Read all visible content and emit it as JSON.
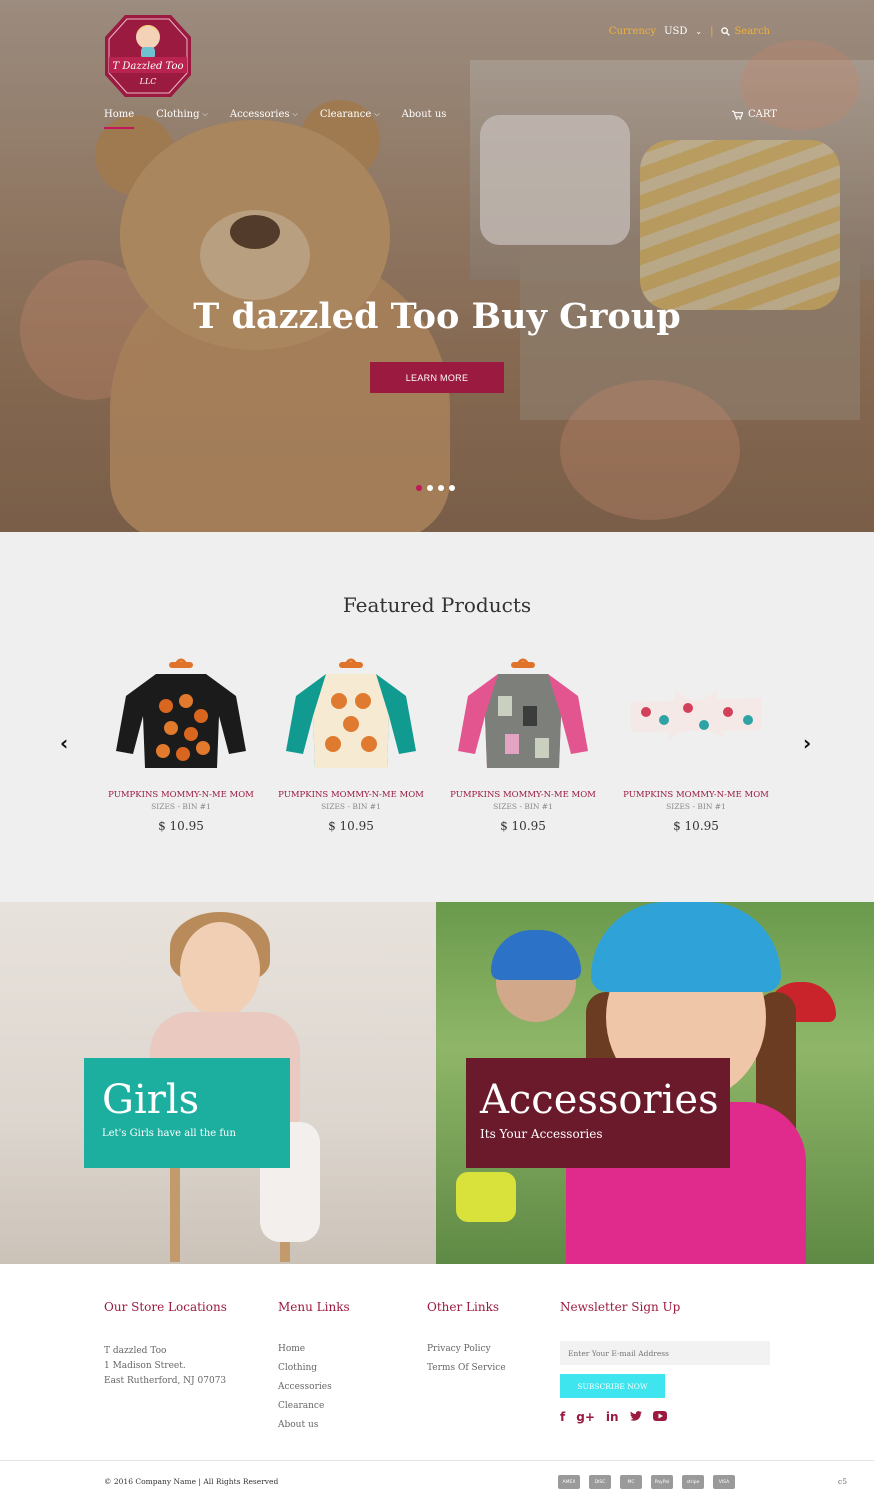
{
  "header": {
    "logo_text": "T Dazzled Too LLC",
    "currency_label": "Currency",
    "currency_value": "USD",
    "search_label": "Search",
    "cart_label": "CART",
    "nav": [
      {
        "label": "Home",
        "active": true
      },
      {
        "label": "Clothing",
        "has_dropdown": true
      },
      {
        "label": "Accessories",
        "has_dropdown": true
      },
      {
        "label": "Clearance",
        "has_dropdown": true
      },
      {
        "label": "About us"
      }
    ]
  },
  "hero": {
    "title": "T dazzled Too Buy Group",
    "button_label": "LEARN MORE",
    "slides": 4,
    "active_slide": 1
  },
  "featured": {
    "title": "Featured Products",
    "products": [
      {
        "name": "PUMPKINS MOMMY-N-ME MOM",
        "sub": "SIZES - BIN #1",
        "price": "$ 10.95",
        "image": "black-pumpkin-shirt"
      },
      {
        "name": "PUMPKINS MOMMY-N-ME MOM",
        "sub": "SIZES - BIN #1",
        "price": "$ 10.95",
        "image": "teal-pumpkin-shirt"
      },
      {
        "name": "PUMPKINS MOMMY-N-ME MOM",
        "sub": "SIZES - BIN #1",
        "price": "$ 10.95",
        "image": "pink-patterned-shirt"
      },
      {
        "name": "PUMPKINS MOMMY-N-ME MOM",
        "sub": "SIZES - BIN #1",
        "price": "$ 10.95",
        "image": "polka-dot-headband"
      }
    ]
  },
  "promos": {
    "girls": {
      "title": "Girls",
      "subtitle": "Let's Girls have all the fun"
    },
    "accessories": {
      "title": "Accessories",
      "subtitle": "Its Your Accessories"
    }
  },
  "footer": {
    "store": {
      "title": "Our Store Locations",
      "lines": [
        "T dazzled Too",
        "1 Madison Street.",
        "East Rutherford, NJ 07073"
      ]
    },
    "menu": {
      "title": "Menu Links",
      "links": [
        "Home",
        "Clothing",
        "Accessories",
        "Clearance",
        "About us"
      ]
    },
    "other": {
      "title": "Other Links",
      "links": [
        "Privacy Policy",
        "Terms Of Service"
      ]
    },
    "newsletter": {
      "title": "Newsletter Sign Up",
      "placeholder": "Enter Your E-mail Address",
      "button_label": "SUBSCRIBE NOW"
    },
    "social_icons": [
      "facebook-icon",
      "google-plus-icon",
      "linkedin-icon",
      "twitter-icon",
      "youtube-icon"
    ],
    "copyright": "© 2016 Company Name | All Rights Reserved",
    "payment_icons": [
      "american-express",
      "discover",
      "mastercard",
      "paypal",
      "stripe",
      "visa"
    ],
    "payment_labels": [
      "AMEX",
      "DISC",
      "MC",
      "PayPal",
      "stripe",
      "VISA"
    ],
    "corner": "c5"
  },
  "colors": {
    "accent": "#9b1a40",
    "gold": "#f0b03c",
    "teal": "#1cae9e",
    "maroon": "#6b1a2c",
    "subscribe": "#3ee5ee"
  }
}
